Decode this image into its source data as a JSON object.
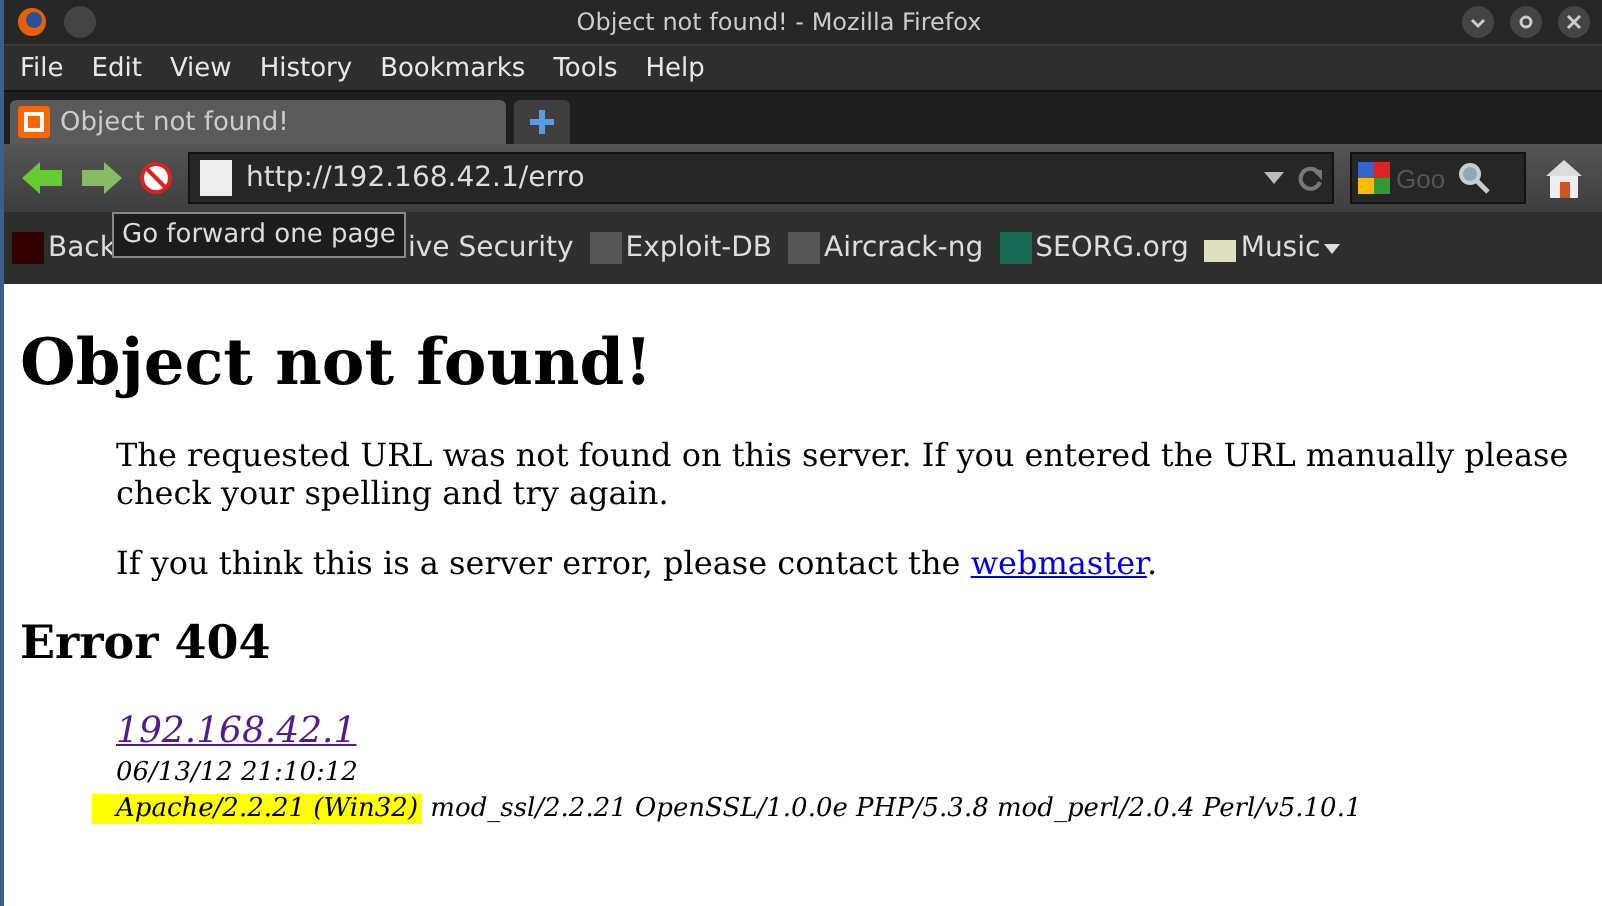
{
  "window": {
    "title": "Object not found! - Mozilla Firefox"
  },
  "menu": [
    "File",
    "Edit",
    "View",
    "History",
    "Bookmarks",
    "Tools",
    "Help"
  ],
  "tabs": [
    {
      "label": "Object not found!",
      "selected": true
    }
  ],
  "address": {
    "value": "http://192.168.42.1/erro"
  },
  "search": {
    "placeholder": "Goo"
  },
  "tooltip": "Go forward one page",
  "bookmarks": [
    {
      "label": "Back",
      "kind": "link"
    },
    {
      "label": "ive Security",
      "kind": "plain"
    },
    {
      "label": "Exploit-DB",
      "kind": "link"
    },
    {
      "label": "Aircrack-ng",
      "kind": "link"
    },
    {
      "label": "SEORG.org",
      "kind": "link"
    },
    {
      "label": "Music",
      "kind": "folder"
    }
  ],
  "page": {
    "heading": "Object not found!",
    "paragraphs": [
      "The requested URL was not found on this server. If you entered the URL manually please check your spelling and try again."
    ],
    "contact": {
      "text": "If you think this is a server error, please contact the ",
      "link": "webmaster",
      "end": "."
    },
    "error": "Error 404",
    "host_link": "192.168.42.1",
    "date": "06/13/12 21:10:12",
    "server_highlighted": "Apache/2.2.21 (Win32)",
    "server_rest": "mod_ssl/2.2.21 OpenSSL/1.0.0e PHP/5.3.8 mod_perl/2.0.4 Perl/v5.10.1"
  }
}
